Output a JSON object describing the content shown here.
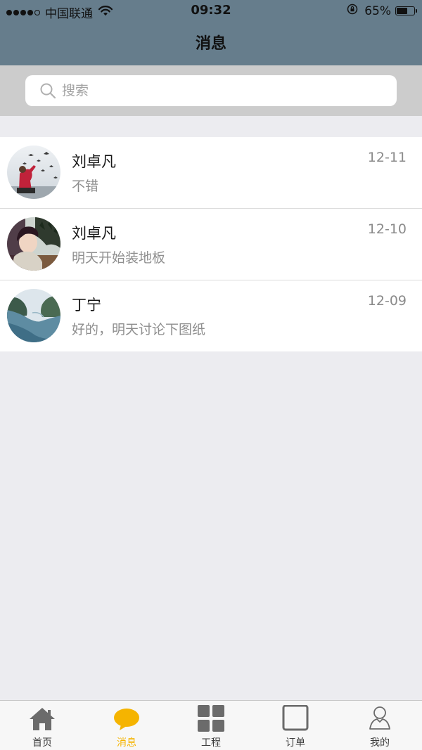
{
  "status_bar": {
    "carrier": "中国联通",
    "time": "09:32",
    "battery": "65%",
    "battery_level": 0.65,
    "signal_bars_filled": 4,
    "signal_bars_total": 5
  },
  "nav": {
    "title": "消息"
  },
  "search": {
    "placeholder": "搜索",
    "value": "",
    "icon": "search-icon"
  },
  "messages": [
    {
      "name": "刘卓凡",
      "preview": "不错",
      "date": "12-11",
      "avatar": "avatar-bird-photo"
    },
    {
      "name": "刘卓凡",
      "preview": "明天开始装地板",
      "date": "12-10",
      "avatar": "avatar-portrait-photo"
    },
    {
      "name": "丁宁",
      "preview": "好的，明天讨论下图纸",
      "date": "12-09",
      "avatar": "avatar-lake-photo"
    }
  ],
  "tabbar": {
    "active_color": "#f5b400",
    "inactive_color": "#6b6b6b",
    "tabs": [
      {
        "label": "首页",
        "icon": "home-icon",
        "active": false
      },
      {
        "label": "消息",
        "icon": "chat-bubble-icon",
        "active": true
      },
      {
        "label": "工程",
        "icon": "grid-icon",
        "active": false
      },
      {
        "label": "订单",
        "icon": "square-icon",
        "active": false
      },
      {
        "label": "我的",
        "icon": "person-icon",
        "active": false
      }
    ]
  },
  "colors": {
    "header_bg": "#667d8c",
    "search_band_bg": "#cccccc",
    "page_bg": "#ececf0"
  }
}
